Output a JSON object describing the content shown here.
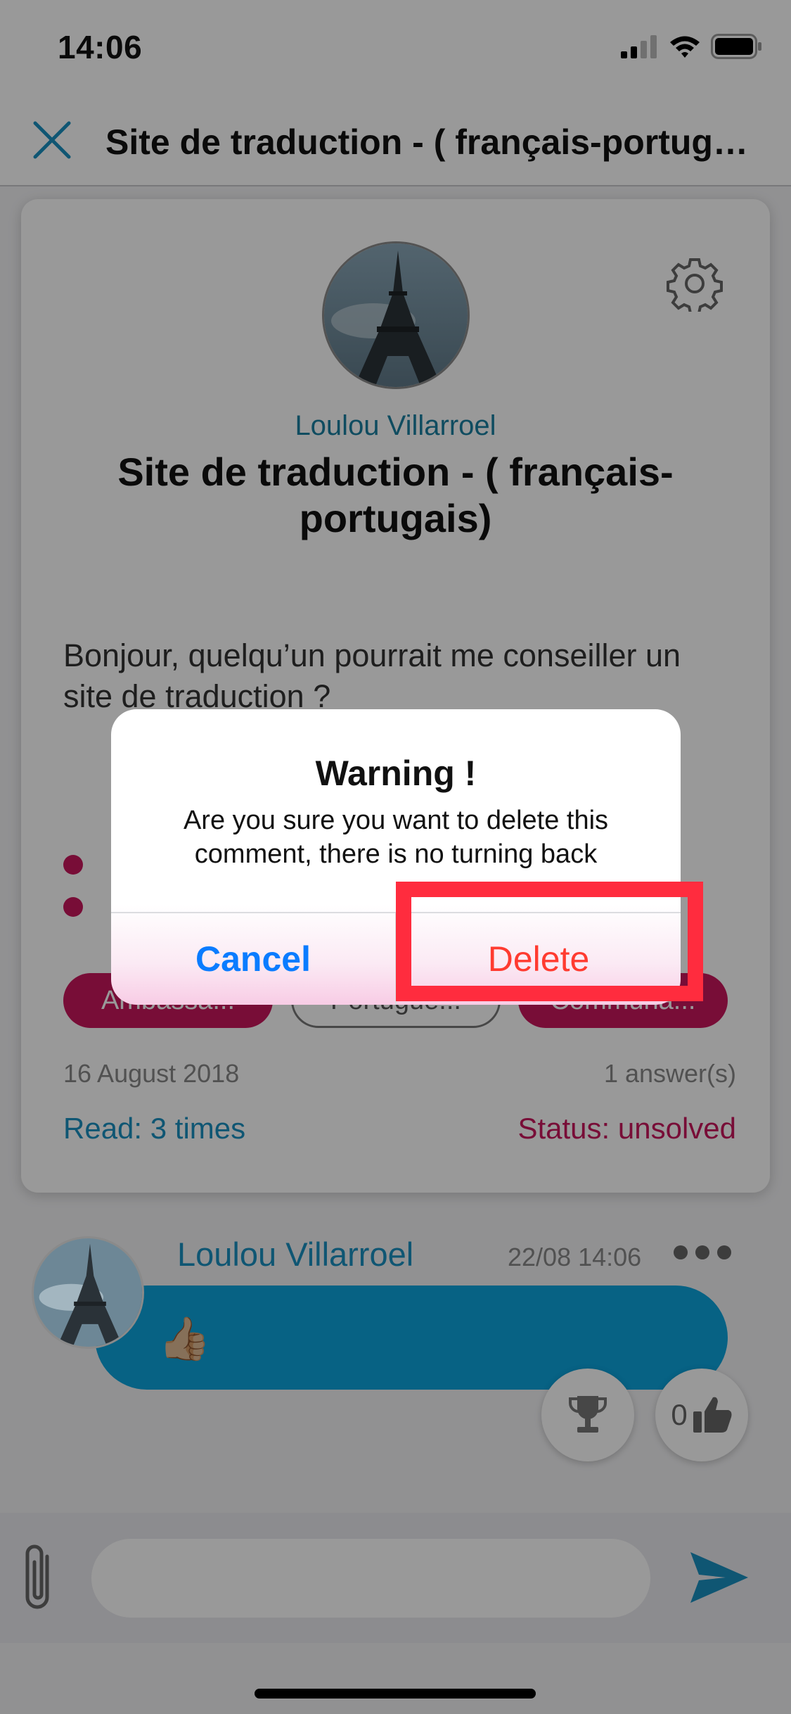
{
  "status_bar": {
    "time": "14:06"
  },
  "nav": {
    "title": "Site de traduction  - ( français-portugais)"
  },
  "post": {
    "author": "Loulou Villarroel",
    "title": "Site de traduction  - ( français-portugais)",
    "body": "Bonjour, quelqu’un pourrait me conseiller un site de traduction ?",
    "tags": [
      "Ambassa...",
      "Portuguê...",
      "Communa..."
    ],
    "date": "16 August 2018",
    "answers": "1 answer(s)",
    "read": "Read: 3 times",
    "status": "Status: unsolved"
  },
  "comment": {
    "author": "Loulou Villarroel",
    "time": "22/08 14:06",
    "text": "👍🏼",
    "likes": "0"
  },
  "composer": {
    "placeholder": ""
  },
  "alert": {
    "title": "Warning !",
    "message": "Are you sure you want to delete this comment, there is no turning back",
    "cancel_label": "Cancel",
    "delete_label": "Delete"
  },
  "colors": {
    "accent_blue": "#1a8fc0",
    "brand_pink": "#c8175d",
    "ios_blue": "#0a7cff",
    "destructive_red": "#ff3b30",
    "highlight_red": "#ff2c3e"
  },
  "icons": {
    "close": "close-icon",
    "settings": "gear-icon",
    "trophy": "trophy-icon",
    "like": "thumbs-up-icon",
    "attach": "paperclip-icon",
    "send": "send-icon"
  }
}
